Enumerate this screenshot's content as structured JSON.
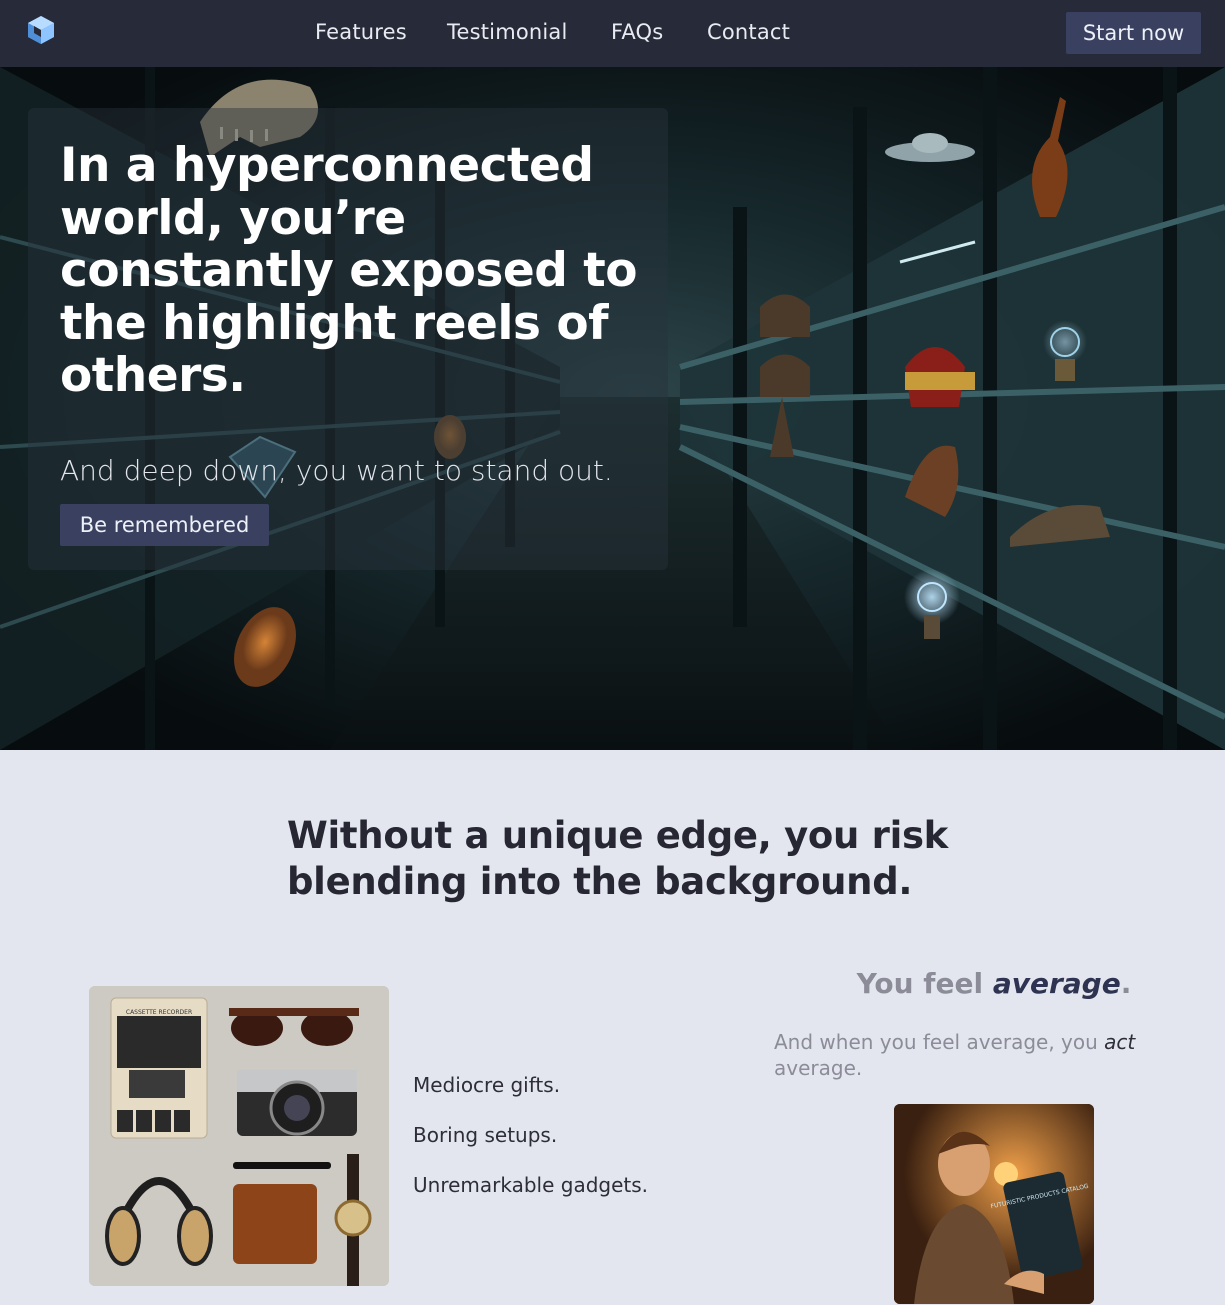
{
  "nav": {
    "logo_icon": "cube-logo-icon",
    "links": [
      "Features",
      "Testimonial",
      "FAQs",
      "Contact"
    ],
    "cta_label": "Start now"
  },
  "hero": {
    "title": "In a hyperconnected world, you’re constantly exposed to the highlight reels of others.",
    "subtitle": "And deep down, you want to stand out.",
    "button_label": "Be remembered"
  },
  "section2": {
    "title": "Without a unique edge, you risk blending into the background.",
    "list": [
      "Mediocre gifts.",
      "Boring setups.",
      "Unremarkable gadgets."
    ],
    "average_title_pre": "You feel ",
    "average_title_em": "average",
    "average_title_post": ".",
    "average_text_pre": "And when you feel average, you ",
    "average_text_em": "act",
    "average_text_post": " average.",
    "cassette_label": "CASSETTE RECORDER",
    "tablet_text": "FUTURISTIC PRODUCTS CATALOG"
  },
  "colors": {
    "nav_bg": "#272a38",
    "button_bg": "#3a4160",
    "page_bg": "#e4e6ef",
    "logo_blue": "#8ec4ff"
  }
}
